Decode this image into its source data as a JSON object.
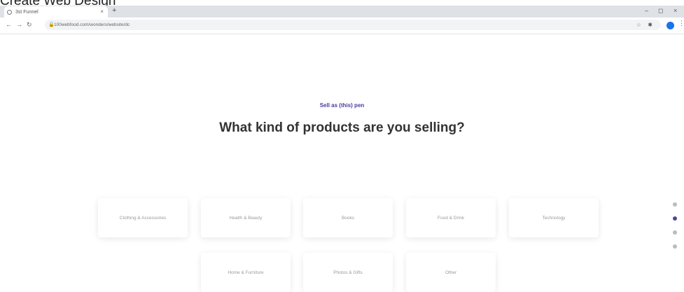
{
  "caption": "Create Web Design",
  "browser": {
    "tab_title": "3st Funnel",
    "tab_close": "×",
    "new_tab": "+",
    "url": "100webfood.com/wonders/website/dc",
    "window_controls": {
      "minimize": "–",
      "restore": "◻",
      "close": "×"
    },
    "menu": "⋮"
  },
  "page": {
    "subtitle": "Sell as (this) pen",
    "heading": "What kind of products are you selling?",
    "categories": [
      "Clothing & Accessories",
      "Health & Beauty",
      "Books",
      "Food & Drink",
      "Technology",
      "Home & Furniture",
      "Photos & Gifts",
      "Other"
    ]
  },
  "pager": {
    "total": 4,
    "active_index": 1
  },
  "colors": {
    "accent": "#4b3a9c",
    "dot_active": "#4b4a8f",
    "dot_inactive": "#b9bcc3"
  }
}
